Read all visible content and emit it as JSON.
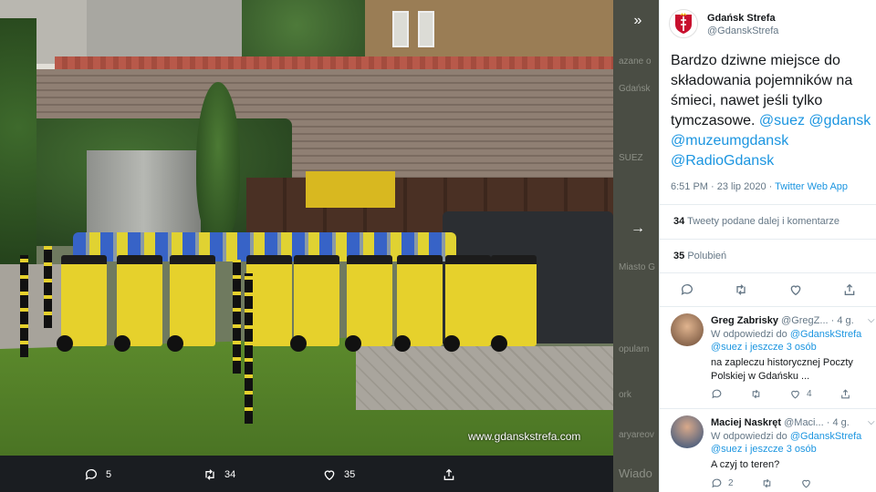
{
  "photo": {
    "watermark": "www.gdanskstrefa.com",
    "actions": {
      "replies": "5",
      "retweets": "34",
      "likes": "35"
    }
  },
  "underlay": {
    "ghost_lines": [
      "azane o",
      "Gdańsk",
      "SUEZ",
      "Miasto G",
      "opularn",
      "ork",
      "aryareov",
      "Wiado"
    ]
  },
  "tweet": {
    "author_name": "Gdańsk Strefa",
    "author_handle": "@GdanskStrefa",
    "text": "Bardzo dziwne miejsce do składowania pojemników na śmieci, nawet jeśli tylko tymczasowe.",
    "mentions": [
      "@suez",
      "@gdansk",
      "@muzeumgdansk",
      "@RadioGdansk"
    ],
    "time": "6:51 PM · 23 lip 2020 ·",
    "app": "Twitter Web App",
    "retweet_count": "34",
    "retweet_label": "Tweety podane dalej i komentarze",
    "like_count": "35",
    "like_label": "Polubień"
  },
  "replies": [
    {
      "name": "Greg Zabrisky",
      "handle": "@GregZ...",
      "age": "· 4 g.",
      "in_reply": "W odpowiedzi do",
      "in_reply_to": "@GdanskStrefa",
      "and_more": "@suez  i jeszcze 3 osób",
      "text": "na zapleczu historycznej Poczty Polskiej w Gdańsku ...",
      "likes": "4"
    },
    {
      "name": "Maciej Naskręt",
      "handle": "@Maci...",
      "age": "· 4 g.",
      "in_reply": "W odpowiedzi do",
      "in_reply_to": "@GdanskStrefa",
      "and_more": "@suez  i jeszcze 3 osób",
      "text": "A czyj to teren?",
      "replies": "2"
    }
  ],
  "colors": {
    "link": "#1b95e0",
    "muted": "#657786",
    "text": "#14171a"
  }
}
